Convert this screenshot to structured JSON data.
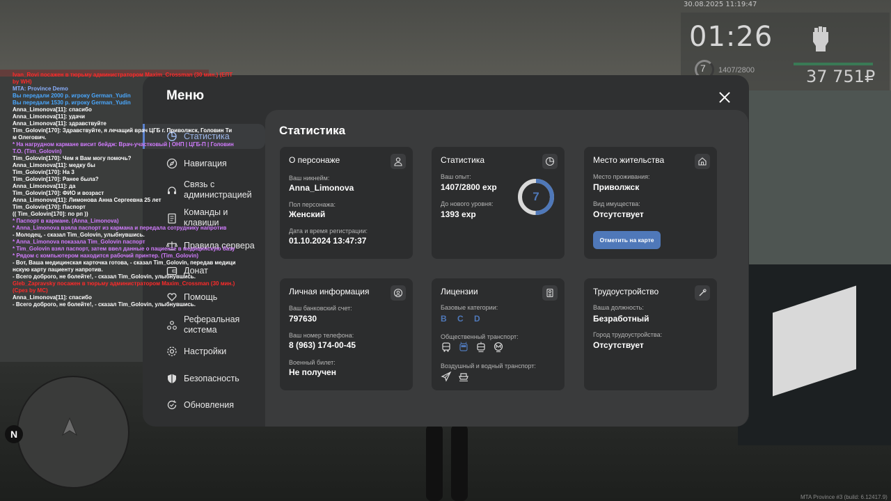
{
  "hud": {
    "datetime": "30.08.2025 11:19:47",
    "time": "01:26",
    "level": "7",
    "exp": "1407/2800",
    "money": "37 751₽"
  },
  "menu": {
    "title": "Меню",
    "content_title": "Статистика",
    "nav": [
      {
        "label": "Статистика",
        "icon": "pie-chart-icon",
        "active": true
      },
      {
        "label": "Навигация",
        "icon": "compass-icon"
      },
      {
        "label": "Связь с администрацией",
        "icon": "headset-icon"
      },
      {
        "label": "Команды и клавиши",
        "icon": "document-icon"
      },
      {
        "label": "Правила сервера",
        "icon": "scales-icon"
      },
      {
        "label": "Донат",
        "icon": "wallet-icon"
      },
      {
        "label": "Помощь",
        "icon": "heart-hand-icon"
      },
      {
        "label": "Реферальная система",
        "icon": "users-icon"
      },
      {
        "label": "Настройки",
        "icon": "gear-icon"
      },
      {
        "label": "Безопасность",
        "icon": "shield-icon"
      },
      {
        "label": "Обновления",
        "icon": "refresh-icon"
      }
    ]
  },
  "cards": {
    "character": {
      "title": "О персонаже",
      "nick_label": "Ваш никнейм:",
      "nick": "Anna_Limonova",
      "gender_label": "Пол персонажа:",
      "gender": "Женский",
      "reg_label": "Дата и время регистрации:",
      "reg": "01.10.2024 13:47:37"
    },
    "stats": {
      "title": "Статистика",
      "exp_label": "Ваш опыт:",
      "exp": "1407/2800 exp",
      "next_label": "До нового уровня:",
      "next": "1393 exp",
      "level": "7",
      "level_progress": 0.5025
    },
    "residence": {
      "title": "Место жительства",
      "place_label": "Место проживания:",
      "place": "Приволжск",
      "property_label": "Вид имущества:",
      "property": "Отсутствует",
      "map_button": "Отметить на карте"
    },
    "personal": {
      "title": "Личная информация",
      "bank_label": "Ваш банковский счет:",
      "bank": "797630",
      "phone_label": "Ваш номер телефона:",
      "phone": "8 (963) 174-00-45",
      "military_label": "Военный билет:",
      "military": "Не получен"
    },
    "licenses": {
      "title": "Лицензии",
      "base_label": "Базовые категории:",
      "base": "B C D",
      "public_label": "Общественный транспорт:",
      "air_label": "Воздушный и водный транспорт:"
    },
    "job": {
      "title": "Трудоустройство",
      "position_label": "Ваша должность:",
      "position": "Безработный",
      "city_label": "Город трудоустройства:",
      "city": "Отсутствует"
    }
  },
  "chat": [
    {
      "text": "Ivan_Rovi посажен в тюрьму администратором Maxim_Crossman (30 мин.) (ЕПТ",
      "color": "#ff2a2a"
    },
    {
      "text": " by WH)",
      "color": "#ff2a2a"
    },
    {
      "text": "MTA: Province Demo",
      "color": "#8ab0ff"
    },
    {
      "text": "Вы передали 2000 р. игроку German_Yudin",
      "color": "#4aa8ff"
    },
    {
      "text": "Вы передали 1530 р. игроку German_Yudin",
      "color": "#4aa8ff"
    },
    {
      "text": "Anna_Limonova[11]: спасибо",
      "color": "#ffffff"
    },
    {
      "text": "Anna_Limonova[11]: удачи",
      "color": "#ffffff"
    },
    {
      "text": "Anna_Limonova[11]: здравствуйте",
      "color": "#ffffff"
    },
    {
      "text": "Tim_Golovin[170]: Здравствуйте, я лечащий врач ЦГБ г. Приволжск, Головин Ти",
      "color": "#ffffff"
    },
    {
      "text": "м Олегович.",
      "color": "#ffffff"
    },
    {
      "text": " * На нагрудном кармане висит бейдж: Врач-участковый | ОНП | ЦГБ-П | Головин",
      "color": "#d27cff"
    },
    {
      "text": "Т.О. (Tim_Golovin)",
      "color": "#d27cff"
    },
    {
      "text": "Tim_Golovin[170]: Чем я Вам могу помочь?",
      "color": "#ffffff"
    },
    {
      "text": "Anna_Limonova[11]: медку бы",
      "color": "#ffffff"
    },
    {
      "text": "Tim_Golovin[170]: На 3",
      "color": "#ffffff"
    },
    {
      "text": "Tim_Golovin[170]: Ранее была?",
      "color": "#ffffff"
    },
    {
      "text": "Anna_Limonova[11]: да",
      "color": "#ffffff"
    },
    {
      "text": "Tim_Golovin[170]: ФИО и возраст",
      "color": "#ffffff"
    },
    {
      "text": "Anna_Limonova[11]: Лимонова Анна Сергеевна 25 лет",
      "color": "#ffffff"
    },
    {
      "text": "Tim_Golovin[170]: Паспорт",
      "color": "#ffffff"
    },
    {
      "text": "(( Tim_Golovin[170]: по рп ))",
      "color": "#ffffff"
    },
    {
      "text": " * Паспорт в кармане. (Anna_Limonova)",
      "color": "#d27cff"
    },
    {
      "text": " * Anna_Limonova взяла паспорт из кармана и передала сотруднику напротив",
      "color": "#d27cff"
    },
    {
      "text": " - Молодец, - сказал Tim_Golovin, улыбнувшись.",
      "color": "#ffffff"
    },
    {
      "text": " * Anna_Limonova показала Tim_Golovin паспорт",
      "color": "#d27cff"
    },
    {
      "text": " * Tim_Golovin взял паспорт, затем ввел данные о пациенте в медицинскую базу",
      "color": "#d27cff"
    },
    {
      "text": " * Рядом с компьютером находится рабочий принтер. (Tim_Golovin)",
      "color": "#d27cff"
    },
    {
      "text": "- Вот, Ваша медицинская карточка готова, - сказал Tim_Golovin, передав медици",
      "color": "#ffffff"
    },
    {
      "text": "нскую карту пациенту напротив.",
      "color": "#ffffff"
    },
    {
      "text": "- Всего доброго, не болейте!, - сказал Tim_Golovin, улыбнувшись.",
      "color": "#ffffff"
    },
    {
      "text": "Gleb_Zapravsky посажен в тюрьму администратором Maxim_Crossman (30 мин.)",
      "color": "#ff2a2a"
    },
    {
      "text": " (Срез by MC)",
      "color": "#ff2a2a"
    },
    {
      "text": "Anna_Limonova[11]: спасибо",
      "color": "#ffffff"
    },
    {
      "text": " - Всего доброго, не болейте!, - сказал Tim_Golovin, улыбнувшись.",
      "color": "#ffffff"
    }
  ],
  "minimap": {
    "north": "N"
  },
  "build": "MTA Province #3 (build: 6.12417.9)"
}
